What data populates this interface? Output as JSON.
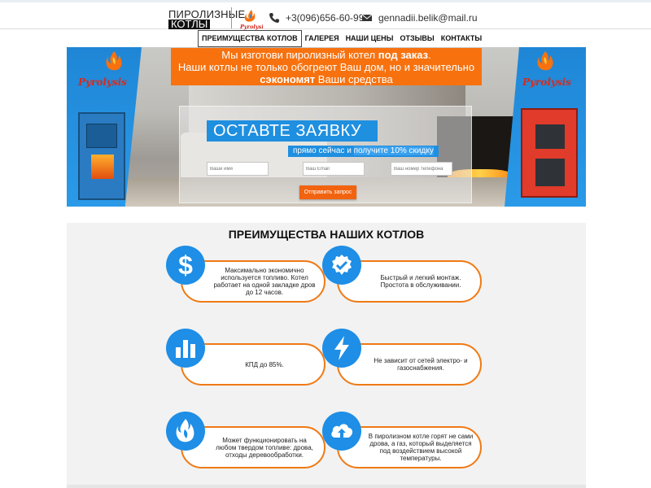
{
  "header": {
    "logo_line1": "ПИРОЛИЗНЫЕ",
    "logo_line2": "КОТЛЫ",
    "logo_brand": "Pyrolysis",
    "phone": "+3(096)656-60-99",
    "email": "gennadii.belik@mail.ru",
    "icons": {
      "phone": "phone-icon",
      "email": "envelope-icon",
      "logo": "flame-logo-icon"
    }
  },
  "nav": [
    {
      "label": "ПРЕИМУЩЕСТВА КОТЛОВ",
      "active": true
    },
    {
      "label": "ГАЛЕРЕЯ",
      "active": false
    },
    {
      "label": "НАШИ ЦЕНЫ",
      "active": false
    },
    {
      "label": "ОТЗЫВЫ",
      "active": false
    },
    {
      "label": "КОНТАКТЫ",
      "active": false
    }
  ],
  "hero": {
    "promo_line1_a": "Мы изготови пиролизный котел ",
    "promo_line1_b": "под заказ",
    "promo_line1_c": ".",
    "promo_line2": "Наши котлы не только обогреют Ваш дом, но и значительно",
    "promo_line3_a": "сэкономят",
    "promo_line3_b": " Ваши средства",
    "brand_left": "Pyrolysis",
    "brand_right": "Pyrolysis",
    "form_title": "ОСТАВТЕ ЗАЯВКУ",
    "form_sub_a": "прямо сейчас и ",
    "form_sub_b": "получите 10% скидку",
    "inputs": {
      "name_placeholder": "Ваше имя",
      "email_placeholder": "Ваш Email",
      "phone_placeholder": "Ваш номер телефона"
    },
    "submit": "Отправить запрос"
  },
  "advantages": {
    "title": "ПРЕИМУЩЕСТВА НАШИХ КОТЛОВ",
    "items": [
      {
        "icon": "dollar-icon",
        "text": "Максимально экономично используется топливо. Котел работает на одной закладке дров до 12 часов."
      },
      {
        "icon": "checkmark-icon",
        "text": "Быстрый и легкий монтаж. Простота в обслуживании."
      },
      {
        "icon": "bar-chart-icon",
        "text": "КПД до 85%."
      },
      {
        "icon": "lightning-icon",
        "text": "Не зависит от сетей электро- и газоснабжения."
      },
      {
        "icon": "fire-icon",
        "text": "Может функционировать на любом твердом топливе: дрова, отходы деревообработки."
      },
      {
        "icon": "cloud-upload-icon",
        "text": "В пиролизном котле горят не сами дрова, а газ, который выделяется под воздействием высокой температуры."
      }
    ]
  },
  "colors": {
    "accent": "#f7720f",
    "blue": "#1e8ee6"
  }
}
